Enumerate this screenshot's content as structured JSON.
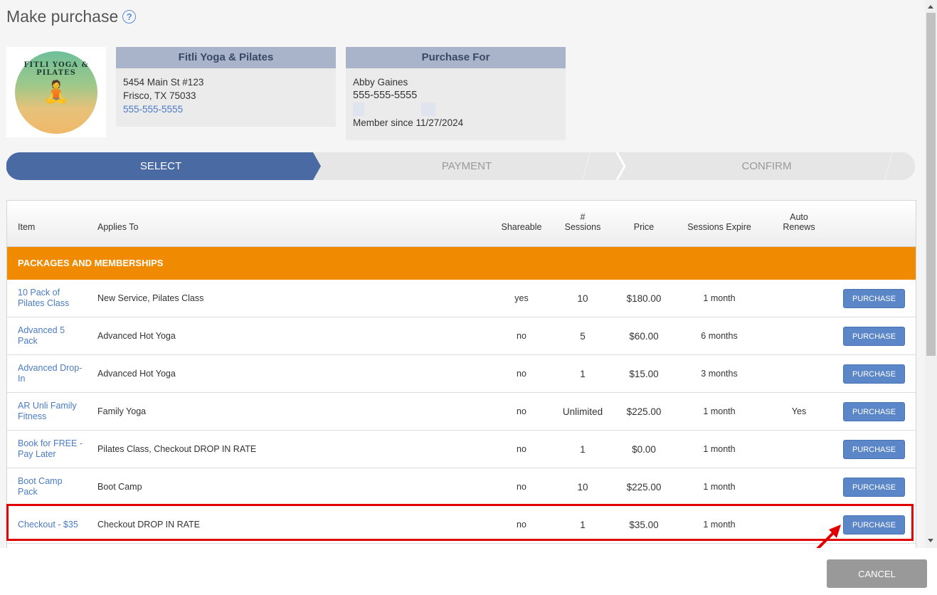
{
  "title": "Make purchase",
  "studio": {
    "name": "Fitli Yoga & Pilates",
    "logo_text": "FITLI YOGA & PILATES",
    "address1": "5454 Main St #123",
    "address2": "Frisco, TX 75033",
    "phone": "555-555-5555"
  },
  "purchase_for": {
    "heading": "Purchase For",
    "name": "Abby Gaines",
    "phone": "555-555-5555",
    "member_since": "Member since 11/27/2024"
  },
  "steps": [
    "SELECT",
    "PAYMENT",
    "CONFIRM"
  ],
  "columns": {
    "item": "Item",
    "applies_to": "Applies To",
    "shareable": "Shareable",
    "sessions_l1": "#",
    "sessions_l2": "Sessions",
    "price": "Price",
    "expire": "Sessions Expire",
    "auto_l1": "Auto",
    "auto_l2": "Renews"
  },
  "section_label": "PACKAGES AND MEMBERSHIPS",
  "rows": [
    {
      "item": "10 Pack of Pilates Class",
      "applies": "New Service, Pilates Class",
      "shareable": "yes",
      "sessions": "10",
      "price": "$180.00",
      "expire": "1 month",
      "auto": "",
      "button": "PURCHASE"
    },
    {
      "item": "Advanced 5 Pack",
      "applies": "Advanced Hot Yoga",
      "shareable": "no",
      "sessions": "5",
      "price": "$60.00",
      "expire": "6 months",
      "auto": "",
      "button": "PURCHASE"
    },
    {
      "item": "Advanced Drop-In",
      "applies": "Advanced Hot Yoga",
      "shareable": "no",
      "sessions": "1",
      "price": "$15.00",
      "expire": "3 months",
      "auto": "",
      "button": "PURCHASE"
    },
    {
      "item": "AR Unli Family Fitness",
      "applies": "Family Yoga",
      "shareable": "no",
      "sessions": "Unlimited",
      "price": "$225.00",
      "expire": "1 month",
      "auto": "Yes",
      "button": "PURCHASE"
    },
    {
      "item": "Book for FREE - Pay Later",
      "applies": "Pilates Class, Checkout DROP IN RATE",
      "shareable": "no",
      "sessions": "1",
      "price": "$0.00",
      "expire": "1 month",
      "auto": "",
      "button": "PURCHASE"
    },
    {
      "item": "Boot Camp Pack",
      "applies": "Boot Camp",
      "shareable": "no",
      "sessions": "10",
      "price": "$225.00",
      "expire": "1 month",
      "auto": "",
      "button": "PURCHASE"
    },
    {
      "item": "Checkout - $35",
      "applies": "Checkout DROP IN RATE",
      "shareable": "no",
      "sessions": "1",
      "price": "$35.00",
      "expire": "1 month",
      "auto": "",
      "button": "PURCHASE"
    }
  ],
  "cancel_label": "CANCEL",
  "colors": {
    "accent": "#4a6aa3",
    "section": "#f08a00",
    "highlight": "#e00000"
  }
}
